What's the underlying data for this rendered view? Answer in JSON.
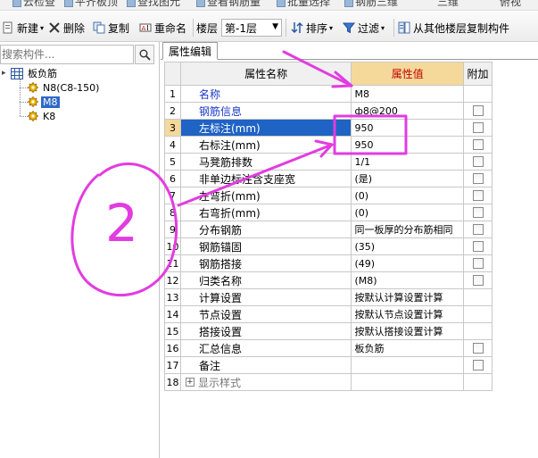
{
  "top_toolbar": {
    "items": [
      "云检查",
      "平齐板顶",
      "查找图元",
      "查看钢筋量",
      "批量选择",
      "钢筋三维",
      "三维",
      "俯视"
    ]
  },
  "toolbar": {
    "new_label": "新建",
    "delete_label": "删除",
    "copy_label": "复制",
    "rename_label": "重命名",
    "floor_label": "楼层",
    "floor_value": "第-1层",
    "sort_label": "排序",
    "filter_label": "过滤",
    "copy_from_floor_label": "从其他楼层复制构件"
  },
  "search": {
    "placeholder": "搜索构件..."
  },
  "tree": {
    "root_label": "板负筋",
    "children": [
      "N8(C8-150)",
      "M8",
      "K8"
    ]
  },
  "panel": {
    "tab_label": "属性编辑",
    "col_name": "属性名称",
    "col_value": "属性值",
    "col_extra": "附加"
  },
  "properties": [
    {
      "num": "1",
      "name": "名称",
      "value": "M8"
    },
    {
      "num": "2",
      "name": "钢筋信息",
      "value": "ф8@200"
    },
    {
      "num": "3",
      "name": "左标注(mm)",
      "value": "950"
    },
    {
      "num": "4",
      "name": "右标注(mm)",
      "value": "950"
    },
    {
      "num": "5",
      "name": "马凳筋排数",
      "value": "1/1"
    },
    {
      "num": "6",
      "name": "非单边标注含支座宽",
      "value": "(是)"
    },
    {
      "num": "7",
      "name": "左弯折(mm)",
      "value": "(0)"
    },
    {
      "num": "8",
      "name": "右弯折(mm)",
      "value": "(0)"
    },
    {
      "num": "9",
      "name": "分布钢筋",
      "value": "同一板厚的分布筋相同"
    },
    {
      "num": "10",
      "name": "钢筋锚固",
      "value": "(35)"
    },
    {
      "num": "11",
      "name": "钢筋搭接",
      "value": "(49)"
    },
    {
      "num": "12",
      "name": "归类名称",
      "value": "(M8)"
    },
    {
      "num": "13",
      "name": "计算设置",
      "value": "按默认计算设置计算"
    },
    {
      "num": "14",
      "name": "节点设置",
      "value": "按默认节点设置计算"
    },
    {
      "num": "15",
      "name": "搭接设置",
      "value": "按默认搭接设置计算"
    },
    {
      "num": "16",
      "name": "汇总信息",
      "value": "板负筋"
    },
    {
      "num": "17",
      "name": "备注",
      "value": ""
    },
    {
      "num": "18",
      "name": "显示样式",
      "value": ""
    }
  ],
  "annotation": {
    "label": "2",
    "ink_color": "#e23ce0"
  },
  "colors": {
    "selection_blue": "#1f63c4",
    "header_gold": "#f5d99a",
    "header_red": "#c00000",
    "name_blue": "#1b37c8"
  }
}
